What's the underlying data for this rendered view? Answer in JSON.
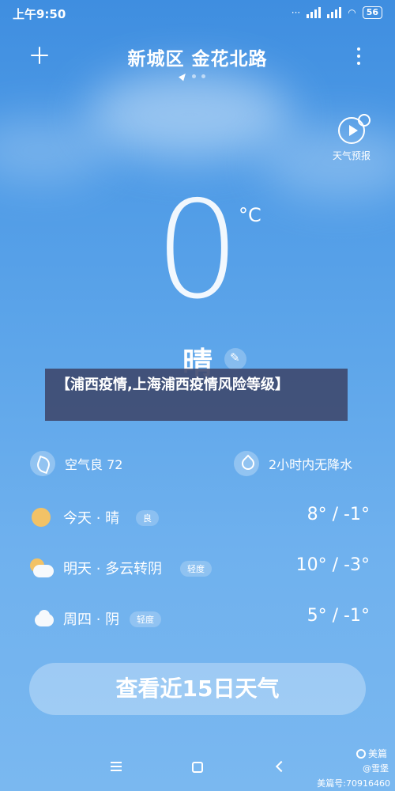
{
  "status_bar": {
    "time": "上午9:50",
    "battery": "56"
  },
  "header": {
    "location": "新城区 金花北路"
  },
  "forecast": {
    "label": "天气预报"
  },
  "current": {
    "temperature": "0",
    "unit": "°C",
    "condition": "晴"
  },
  "banner": {
    "text": "【浦西疫情,上海浦西疫情风险等级】"
  },
  "air": {
    "label": "空气良 72"
  },
  "precip": {
    "label": "2小时内无降水"
  },
  "days": [
    {
      "label": "今天 · 晴",
      "badge": "良",
      "temps": "8° / -1°",
      "icon": "sun-icon"
    },
    {
      "label": "明天 · 多云转阴",
      "badge": "轻度",
      "temps": "10° / -3°",
      "icon": "partly-cloudy-icon"
    },
    {
      "label": "周四 · 阴",
      "badge": "轻度",
      "temps": "5° / -1°",
      "icon": "cloud-icon"
    }
  ],
  "button_15day": "查看近15日天气",
  "watermark": {
    "brand": "美篇",
    "user": "@雪堡",
    "id": "美篇号:70916460"
  },
  "colors": {
    "sky_top": "#3f8ee0",
    "sky_bottom": "#7ab8f0",
    "banner": "#3e486e",
    "sun": "#f2c266"
  }
}
